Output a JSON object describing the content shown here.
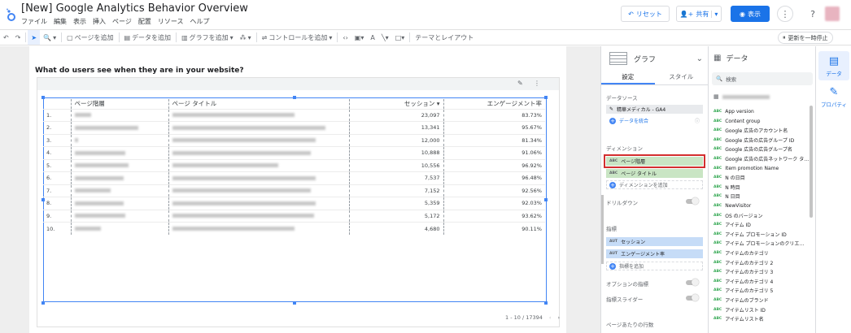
{
  "header": {
    "title": "[New] Google Analytics Behavior Overview",
    "menu": [
      "ファイル",
      "編集",
      "表示",
      "挿入",
      "ページ",
      "配置",
      "リソース",
      "ヘルプ"
    ],
    "reset_label": "リセット",
    "share_label": "共有",
    "view_label": "表示"
  },
  "toolbar": {
    "add_page": "ページを追加",
    "add_data": "データを追加",
    "add_chart": "グラフを追加",
    "add_control": "コントロールを追加",
    "theme_layout": "テーマとレイアウト",
    "refresh_pause": "更新を一時停止"
  },
  "canvas": {
    "section_title": "What do users see when they are in your website?",
    "table": {
      "headers": [
        "ページ階層",
        "ページ タイトル",
        "セッション",
        "エンゲージメント率"
      ],
      "sort_indicator": "▾",
      "rows": [
        {
          "n": "1.",
          "sessions": "23,097",
          "rate": "83.73%"
        },
        {
          "n": "2.",
          "sessions": "13,341",
          "rate": "95.67%"
        },
        {
          "n": "3.",
          "sessions": "12,000",
          "rate": "81.34%"
        },
        {
          "n": "4.",
          "sessions": "10,888",
          "rate": "91.06%"
        },
        {
          "n": "5.",
          "sessions": "10,556",
          "rate": "96.92%"
        },
        {
          "n": "6.",
          "sessions": "7,537",
          "rate": "96.48%"
        },
        {
          "n": "7.",
          "sessions": "7,152",
          "rate": "92.56%"
        },
        {
          "n": "8.",
          "sessions": "5,359",
          "rate": "92.03%"
        },
        {
          "n": "9.",
          "sessions": "5,172",
          "rate": "93.62%"
        },
        {
          "n": "10.",
          "sessions": "4,680",
          "rate": "90.11%"
        }
      ]
    },
    "pagination": "1 - 10 / 17394"
  },
  "properties": {
    "chart_type": "グラフ",
    "tab_setup": "設定",
    "tab_style": "スタイル",
    "datasource_label": "データソース",
    "datasource_name": "精華メディカル - GA4",
    "blend_label": "データを統合",
    "dimension_label": "ディメンション",
    "dimensions": [
      "ページ階層",
      "ページ タイトル"
    ],
    "add_dimension": "ディメンションを追加",
    "drilldown_label": "ドリルダウン",
    "metric_label": "指標",
    "metrics": [
      "セッション",
      "エンゲージメント率"
    ],
    "add_metric": "指標を追加",
    "optional_metrics": "オプションの指標",
    "metric_slider": "指標スライダー",
    "rows_per_page": "ページあたりの行数",
    "dim_tag": "ABC",
    "metric_tag": "AUT"
  },
  "data_panel": {
    "title": "データ",
    "search_placeholder": "検索",
    "field_tag": "ABC",
    "fields": [
      "App version",
      "Content group",
      "Google 広告のアカウント名",
      "Google 広告の広告グループ ID",
      "Google 広告の広告グループ名",
      "Google 広告の広告ネットワーク タ…",
      "Item promotion Name",
      "N の日目",
      "N 時目",
      "N 日目",
      "NewVisitor",
      "OS のバージョン",
      "アイテム ID",
      "アイテム プロモーション ID",
      "アイテム プロモーションのクリエ…",
      "アイテムのカテゴリ",
      "アイテムのカテゴリ 2",
      "アイテムのカテゴリ 3",
      "アイテムのカテゴリ 4",
      "アイテムのカテゴリ 5",
      "アイテムのブランド",
      "アイテムリスト ID",
      "アイテムリスト名"
    ]
  },
  "rail": {
    "data_label": "データ",
    "property_label": "プロパティ"
  }
}
